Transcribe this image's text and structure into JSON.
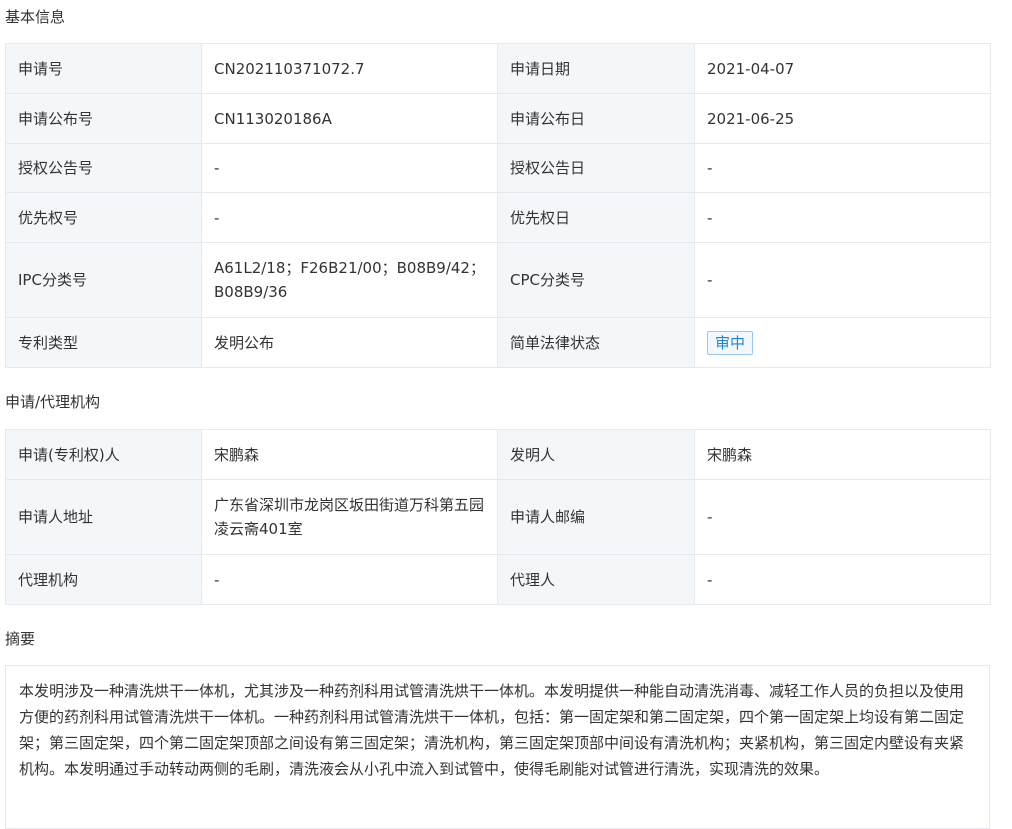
{
  "sections": {
    "basic_title": "基本信息",
    "agency_title": "申请/代理机构",
    "abstract_title": "摘要"
  },
  "basic_info": {
    "rows": [
      {
        "label1": "申请号",
        "value1": "CN202110371072.7",
        "label2": "申请日期",
        "value2": "2021-04-07"
      },
      {
        "label1": "申请公布号",
        "value1": "CN113020186A",
        "label2": "申请公布日",
        "value2": "2021-06-25"
      },
      {
        "label1": "授权公告号",
        "value1": "-",
        "label2": "授权公告日",
        "value2": "-"
      },
      {
        "label1": "优先权号",
        "value1": "-",
        "label2": "优先权日",
        "value2": "-"
      },
      {
        "label1": "IPC分类号",
        "value1": "A61L2/18；F26B21/00；B08B9/42；B08B9/36",
        "label2": "CPC分类号",
        "value2": "-"
      },
      {
        "label1": "专利类型",
        "value1": "发明公布",
        "label2": "简单法律状态",
        "value2": "审中"
      }
    ]
  },
  "agency_info": {
    "rows": [
      {
        "label1": "申请(专利权)人",
        "value1": "宋鹏森",
        "label2": "发明人",
        "value2": "宋鹏森"
      },
      {
        "label1": "申请人地址",
        "value1": "广东省深圳市龙岗区坂田街道万科第五园凌云斋401室",
        "label2": "申请人邮编",
        "value2": "-"
      },
      {
        "label1": "代理机构",
        "value1": "-",
        "label2": "代理人",
        "value2": "-"
      }
    ]
  },
  "abstract": {
    "text": "本发明涉及一种清洗烘干一体机，尤其涉及一种药剂科用试管清洗烘干一体机。本发明提供一种能自动清洗消毒、减轻工作人员的负担以及使用方便的药剂科用试管清洗烘干一体机。一种药剂科用试管清洗烘干一体机，包括：第一固定架和第二固定架，四个第一固定架上均设有第二固定架；第三固定架，四个第二固定架顶部之间设有第三固定架；清洗机构，第三固定架顶部中间设有清洗机构；夹紧机构，第三固定内壁设有夹紧机构。本发明通过手动转动两侧的毛刷，清洗液会从小孔中流入到试管中，使得毛刷能对试管进行清洗，实现清洗的效果。"
  },
  "colors": {
    "label_bg": "#f4f7fa",
    "border": "#e6eaef",
    "badge_text": "#1e84d8",
    "badge_border": "#99c8ef"
  }
}
